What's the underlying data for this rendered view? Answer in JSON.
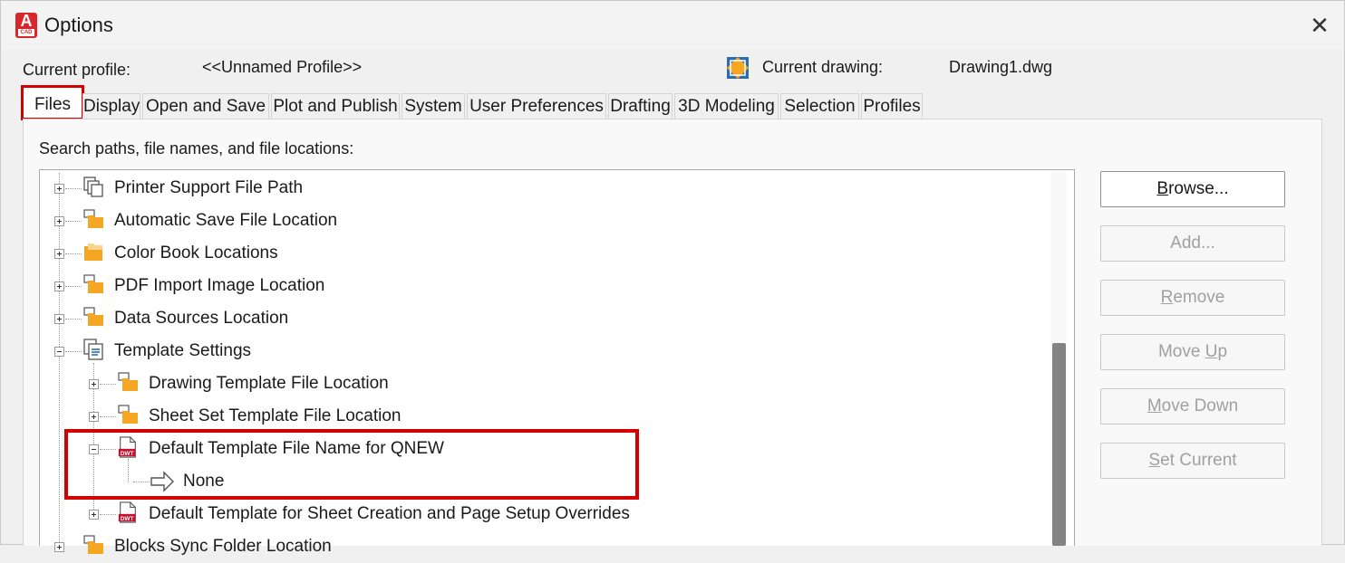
{
  "window": {
    "title": "Options",
    "app_icon_letter": "A",
    "app_icon_sub": "CAD",
    "close_glyph": "✕"
  },
  "profile": {
    "label": "Current profile:",
    "value": "<<Unnamed Profile>>"
  },
  "drawing": {
    "label": "Current drawing:",
    "value": "Drawing1.dwg"
  },
  "tabs": [
    {
      "label": "Files"
    },
    {
      "label": "Display"
    },
    {
      "label": "Open and Save"
    },
    {
      "label": "Plot and Publish"
    },
    {
      "label": "System"
    },
    {
      "label": "User Preferences"
    },
    {
      "label": "Drafting"
    },
    {
      "label": "3D Modeling"
    },
    {
      "label": "Selection"
    },
    {
      "label": "Profiles"
    }
  ],
  "section_label": "Search paths, file names, and file locations:",
  "tree": [
    {
      "label": "Printer Support File Path",
      "icon": "printer-support-icon"
    },
    {
      "label": "Automatic Save File Location",
      "icon": "folder-icon"
    },
    {
      "label": "Color Book Locations",
      "icon": "folder-icon"
    },
    {
      "label": "PDF Import Image Location",
      "icon": "folder-icon"
    },
    {
      "label": "Data Sources Location",
      "icon": "folder-icon"
    },
    {
      "label": "Template Settings",
      "icon": "template-settings-icon"
    },
    {
      "label": "Drawing Template File Location",
      "icon": "folder-icon"
    },
    {
      "label": "Sheet Set Template File Location",
      "icon": "folder-icon"
    },
    {
      "label": "Default Template File Name for QNEW",
      "icon": "dwt-file-icon"
    },
    {
      "label": "None",
      "icon": "arrow-right-icon"
    },
    {
      "label": "Default Template for Sheet Creation and Page Setup Overrides",
      "icon": "dwt-file-icon"
    },
    {
      "label": "Blocks Sync Folder Location",
      "icon": "folder-icon"
    }
  ],
  "buttons": {
    "browse": {
      "pre": "",
      "key": "B",
      "post": "rowse..."
    },
    "add": {
      "pre": "Add",
      "key": "",
      "post": "..."
    },
    "remove": {
      "pre": "",
      "key": "R",
      "post": "emove"
    },
    "move_up": {
      "pre": "Move ",
      "key": "U",
      "post": "p"
    },
    "move_down": {
      "pre": "",
      "key": "M",
      "post": "ove Down"
    },
    "set_current": {
      "pre": "",
      "key": "S",
      "post": "et Current"
    }
  },
  "colors": {
    "highlight": "#d40000",
    "folder": "#f5a623",
    "dwt_red": "#c8102e",
    "accent_blue": "#2b6cb0"
  }
}
